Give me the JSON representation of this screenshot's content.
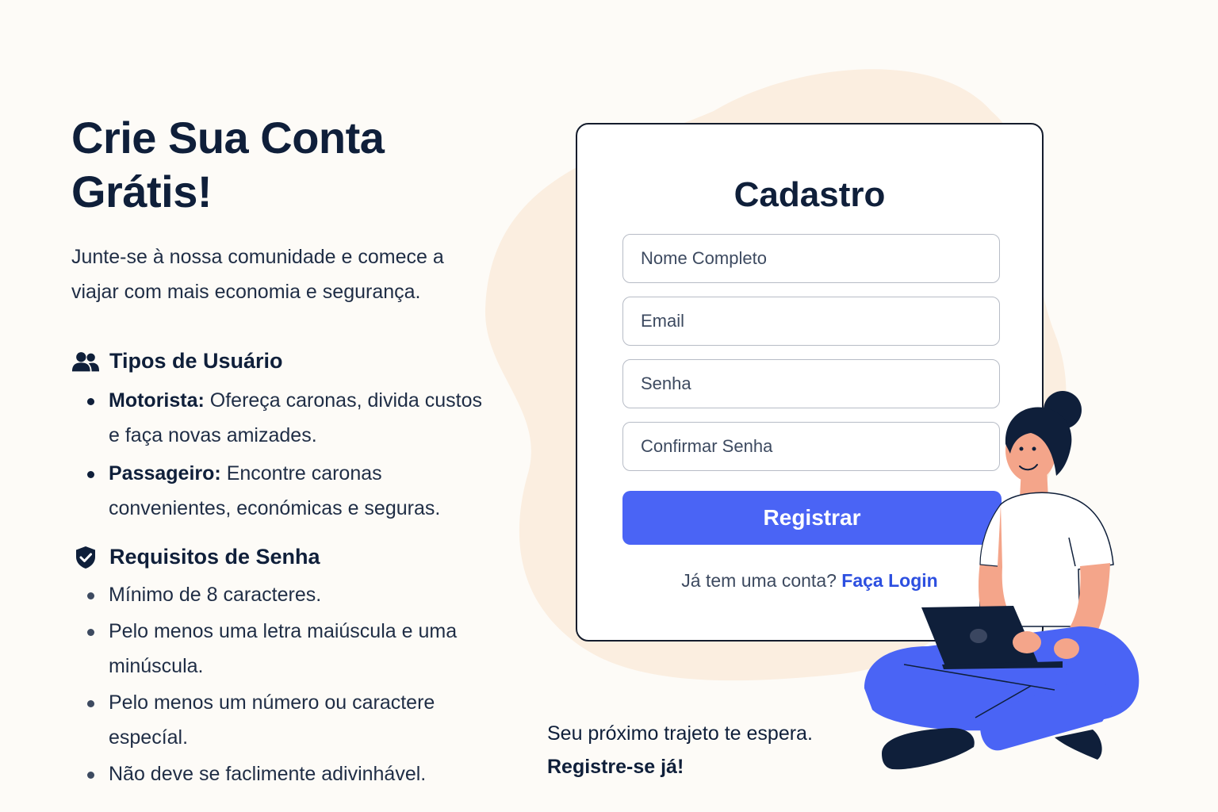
{
  "hero": {
    "title_line1": "Crie Sua Conta",
    "title_line2": "Grátis!",
    "subtitle": "Junte-se à nossa comunidade e comece a viajar com mais economia e segurança."
  },
  "user_types": {
    "heading": "Tipos de Usuário",
    "icon": "users-icon",
    "items": [
      {
        "label": "Motorista:",
        "text": " Ofereça caronas, divida custos e faça novas amizades."
      },
      {
        "label": "Passageiro:",
        "text": " Encontre caronas convenientes, económicas e seguras."
      }
    ]
  },
  "password_requirements": {
    "heading": "Requisitos de Senha",
    "icon": "shield-check-icon",
    "items": [
      "Mínimo de 8 caracteres.",
      "Pelo menos uma letra maiúscula e uma minúscula.",
      "Pelo menos um  número ou caractere especíal.",
      "Não deve se faclimente adivinhável."
    ]
  },
  "signup_form": {
    "title": "Cadastro",
    "fields": {
      "full_name_placeholder": "Nome Completo",
      "email_placeholder": "Email",
      "password_placeholder": "Senha",
      "confirm_password_placeholder": "Confirmar Senha"
    },
    "submit_label": "Registrar",
    "login_prompt": "Já tem uma conta?",
    "login_link": "Faça Login"
  },
  "footer": {
    "message": "Seu próximo trajeto te espera.",
    "cta": "Registre-se já!"
  },
  "colors": {
    "background": "#fdfbf7",
    "blob": "#fbeee0",
    "primary": "#4a64f5",
    "text_dark": "#0f1f3a",
    "link": "#2c4fe0"
  }
}
